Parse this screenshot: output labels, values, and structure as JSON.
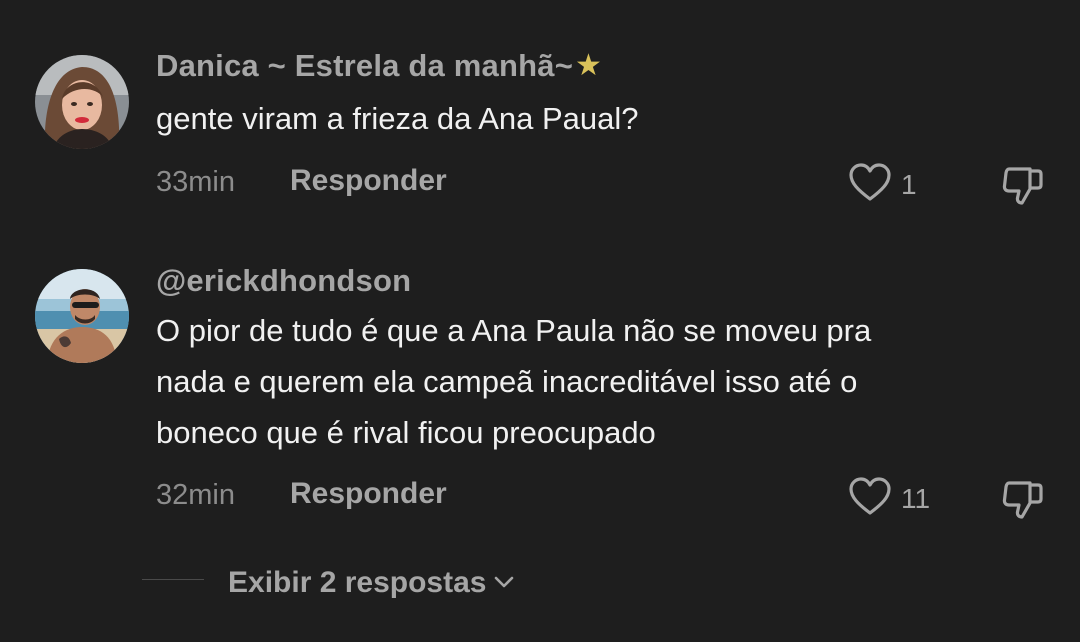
{
  "comments": [
    {
      "username": "Danica ~ Estrela da manhã~",
      "username_suffix_icon": "star-icon",
      "text": "gente viram a frieza da Ana Paual?",
      "time": "33min",
      "reply_label": "Responder",
      "likes": "1",
      "like_icon": "heart-outline-icon",
      "dislike_icon": "thumbs-down-icon",
      "avatar_icon": "profile-photo-woman"
    },
    {
      "username": "@erickdhondson",
      "text_lines": [
        "O pior de tudo é que a Ana Paula não se moveu pra",
        "nada e querem ela campeã inacreditável isso até o",
        "boneco que é rival ficou preocupado"
      ],
      "time": "32min",
      "reply_label": "Responder",
      "likes": "11",
      "like_icon": "heart-outline-icon",
      "dislike_icon": "thumbs-down-icon",
      "avatar_icon": "profile-photo-man-beach"
    }
  ],
  "view_replies": {
    "label": "Exibir 2 respostas",
    "icon": "chevron-down-icon"
  },
  "colors": {
    "background": "#1e1e1e",
    "primary_text": "#f1f1f1",
    "secondary_text": "#a6a6a6",
    "star": "#d9c15a"
  }
}
